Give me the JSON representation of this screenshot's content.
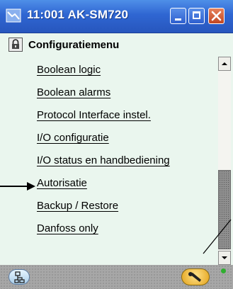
{
  "window": {
    "title": "11:001 AK-SM720",
    "title_icon": "device-connection-icon"
  },
  "header": {
    "icon": "lock-icon",
    "title": "Configuratiemenu"
  },
  "menu": {
    "items": [
      {
        "label": "Boolean logic"
      },
      {
        "label": "Boolean alarms"
      },
      {
        "label": "Protocol Interface instel."
      },
      {
        "label": "I/O configuratie"
      },
      {
        "label": "I/O status en handbediening"
      },
      {
        "label": "Autorisatie"
      },
      {
        "label": "Backup / Restore"
      },
      {
        "label": "Danfoss only"
      }
    ]
  },
  "statusbar": {
    "left_icon": "network-icon",
    "right_icon": "wrench-icon",
    "indicator_color": "#2faf2f"
  },
  "colors": {
    "titlebar": "#2f66d2",
    "content_bg": "#eaf6ee",
    "close_button": "#c24722"
  }
}
